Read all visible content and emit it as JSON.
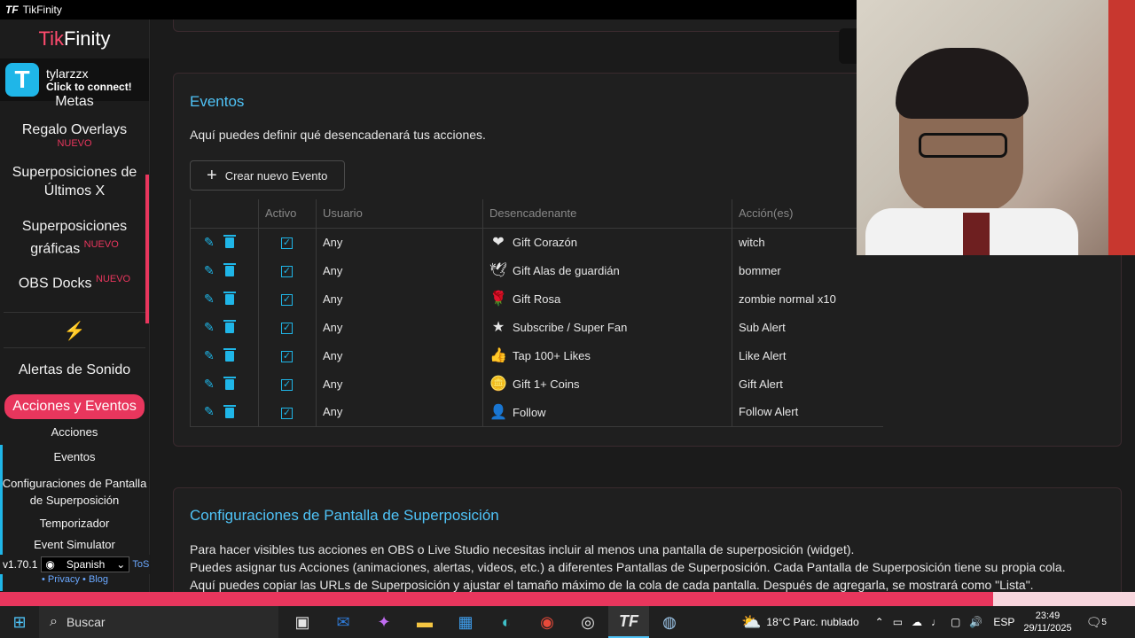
{
  "titlebar": {
    "app": "TikFinity",
    "logo": "TF"
  },
  "sidebar": {
    "brand_tik": "Tik",
    "brand_finity": "Finity",
    "user": {
      "avatar": "T",
      "name": "tylarzzx",
      "sub": "Click to connect!"
    },
    "items": [
      {
        "label": "Metas"
      },
      {
        "label": "Regalo Overlays",
        "badge": "NUEVO"
      },
      {
        "label": "Superposiciones de Últimos X"
      },
      {
        "label": "Superposiciones gráficas",
        "badge": "NUEVO"
      },
      {
        "label": "OBS Docks",
        "badge": "NUEVO"
      },
      {
        "label": "Alertas de Sonido"
      },
      {
        "label": "Acciones y Eventos"
      }
    ],
    "sub_items": [
      "Acciones",
      "Eventos",
      "Configuraciones de Pantalla de Superposición",
      "Temporizador",
      "Event Simulator"
    ],
    "version": "v1.70.1",
    "language": "Spanish",
    "tos": "ToS",
    "privacy": "Privacy",
    "blog": "Blog"
  },
  "events": {
    "title": "Eventos",
    "description": "Aquí puedes definir qué desencadenará tus acciones.",
    "create_button": "Crear nuevo Evento",
    "columns": [
      "Activo",
      "Usuario",
      "Desencadenante",
      "Acción(es)"
    ],
    "rows": [
      {
        "user": "Any",
        "trigger": "Gift Corazón",
        "trigger_icon": "❤",
        "action": "witch"
      },
      {
        "user": "Any",
        "trigger": "Gift Alas de guardián",
        "trigger_icon": "🕊",
        "action": "bommer"
      },
      {
        "user": "Any",
        "trigger": "Gift Rosa",
        "trigger_icon": "🌹",
        "action": "zombie normal x10"
      },
      {
        "user": "Any",
        "trigger": "Subscribe / Super Fan",
        "trigger_icon": "★",
        "action": "Sub Alert"
      },
      {
        "user": "Any",
        "trigger": "Tap 100+ Likes",
        "trigger_icon": "👍",
        "action": "Like Alert"
      },
      {
        "user": "Any",
        "trigger": "Gift 1+ Coins",
        "trigger_icon": "🪙",
        "action": "Gift Alert"
      },
      {
        "user": "Any",
        "trigger": "Follow",
        "trigger_icon": "👤",
        "action": "Follow Alert"
      }
    ]
  },
  "overlay_settings": {
    "title": "Configuraciones de Pantalla de Superposición",
    "line1": "Para hacer visibles tus acciones en OBS o Live Studio necesitas incluir al menos una pantalla de superposición (widget).",
    "line2": "Puedes asignar tus Acciones (animaciones, alertas, videos, etc.) a diferentes Pantallas de Superposición. Cada Pantalla de Superposición tiene su propia cola.",
    "line3": "Aquí puedes copiar las URLs de Superposición y ajustar el tamaño máximo de la cola de cada pantalla. Después de agregarla, se mostrará como \"Lista\"."
  },
  "taskbar": {
    "search": "Buscar",
    "weather": "18°C  Parc. nublado",
    "lang": "ESP",
    "time": "23:49",
    "date": "29/11/2025",
    "notif_count": "5"
  },
  "colors": {
    "accent_pink": "#e8365d",
    "accent_blue": "#4fc3f7",
    "cyan": "#1fb6e8"
  }
}
